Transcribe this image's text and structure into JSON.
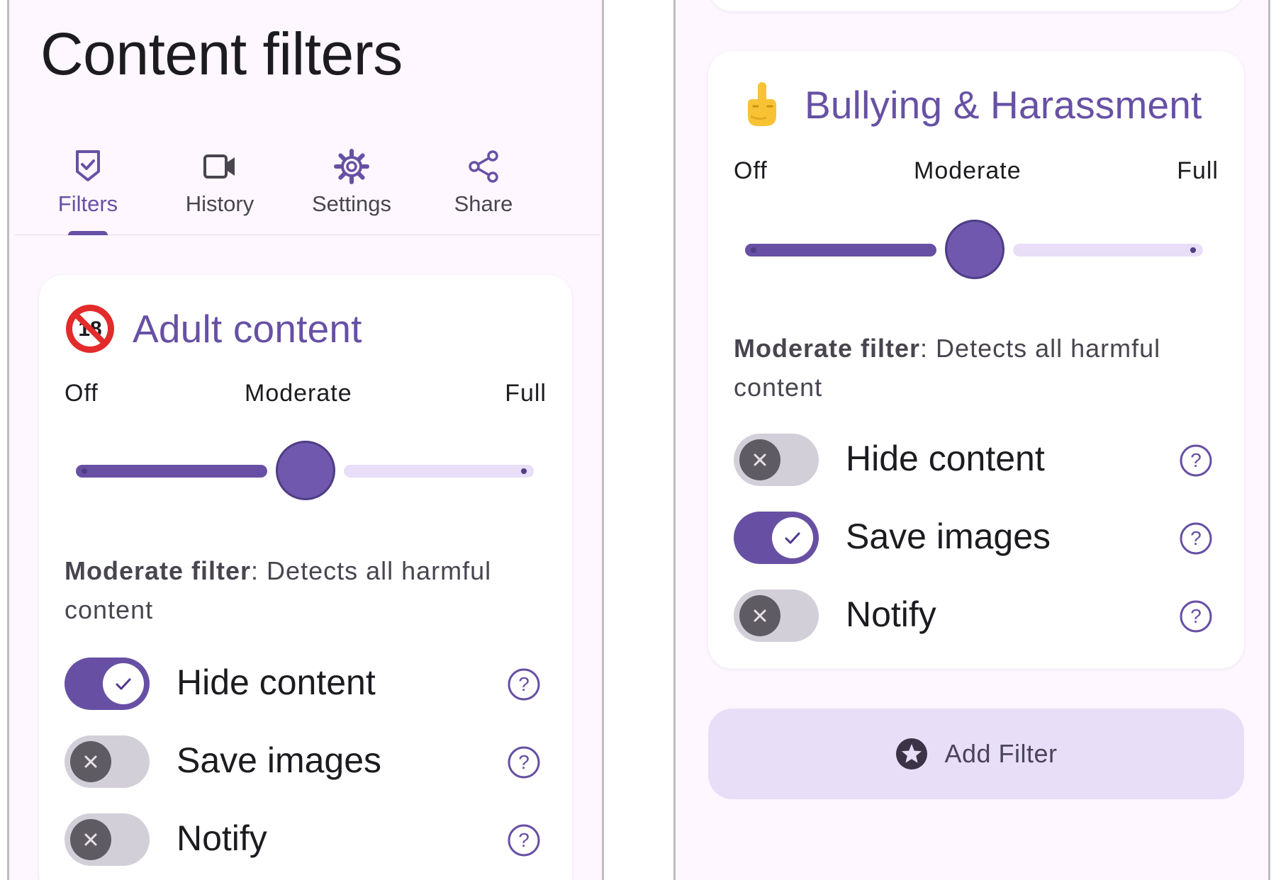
{
  "colors": {
    "primary": "#6750a4",
    "secondary_container": "#e8def8",
    "background": "#fef7ff",
    "switch_off": "#d3cfd8"
  },
  "left_screen": {
    "title": "Content filters",
    "tabs": [
      {
        "label": "Filters",
        "icon": "shield-check-icon",
        "active": true
      },
      {
        "label": "History",
        "icon": "video-camera-icon",
        "active": false
      },
      {
        "label": "Settings",
        "icon": "gear-icon",
        "active": false
      },
      {
        "label": "Share",
        "icon": "share-icon",
        "active": false
      }
    ],
    "card": {
      "icon": "no-one-under-eighteen-emoji",
      "title": "Adult content",
      "slider": {
        "labels": [
          "Off",
          "Moderate",
          "Full"
        ],
        "value": "Moderate",
        "level": 0.5
      },
      "desc_bold": "Moderate filter",
      "desc_rest": ": Detects all harmful content",
      "toggles": [
        {
          "label": "Hide content",
          "on": true
        },
        {
          "label": "Save images",
          "on": false
        },
        {
          "label": "Notify",
          "on": false
        }
      ]
    }
  },
  "right_screen": {
    "card": {
      "icon": "middle-finger-emoji",
      "title": "Bullying & Harassment",
      "slider": {
        "labels": [
          "Off",
          "Moderate",
          "Full"
        ],
        "value": "Moderate",
        "level": 0.5
      },
      "desc_bold": "Moderate filter",
      "desc_rest": ": Detects all harmful content",
      "toggles": [
        {
          "label": "Hide content",
          "on": false
        },
        {
          "label": "Save images",
          "on": true
        },
        {
          "label": "Notify",
          "on": false
        }
      ]
    },
    "add_filter_label": "Add Filter",
    "add_filter_icon": "star-circle-icon"
  }
}
